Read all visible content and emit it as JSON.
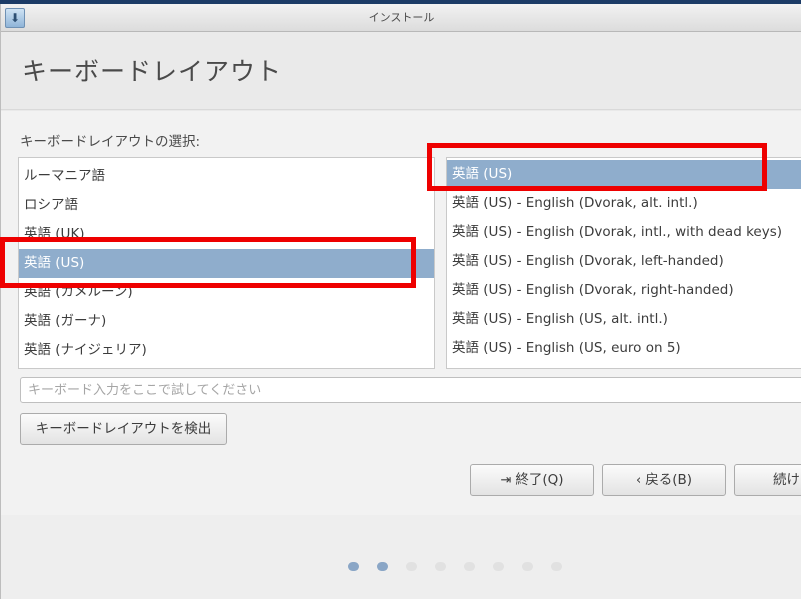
{
  "window": {
    "title": "インストール"
  },
  "header": {
    "title": "キーボードレイアウト"
  },
  "main": {
    "section_label": "キーボードレイアウトの選択:",
    "languages": [
      "ルーマニア語",
      "ロシア語",
      "英語 (UK)",
      "英語 (US)",
      "英語 (カメルーン)",
      "英語 (ガーナ)",
      "英語 (ナイジェリア)"
    ],
    "selected_language": "英語 (US)",
    "layouts": [
      "英語 (US)",
      "英語 (US) - English (Dvorak, alt. intl.)",
      "英語 (US) - English (Dvorak, intl., with dead keys)",
      "英語 (US) - English (Dvorak, left-handed)",
      "英語 (US) - English (Dvorak, right-handed)",
      "英語 (US) - English (US, alt. intl.)",
      "英語 (US) - English (US, euro on 5)"
    ],
    "selected_layout": "英語 (US)",
    "test_input_placeholder": "キーボード入力をここで試してください",
    "detect_button": "キーボードレイアウトを検出"
  },
  "buttons": {
    "quit": "終了(Q)",
    "back": "戻る(B)",
    "next": "続け"
  },
  "progress": {
    "total_steps": 8,
    "current_step": 2
  },
  "colors": {
    "selection": "#8fadcc",
    "highlight": "#ee0000",
    "active_dot": "#8aa6c6"
  }
}
